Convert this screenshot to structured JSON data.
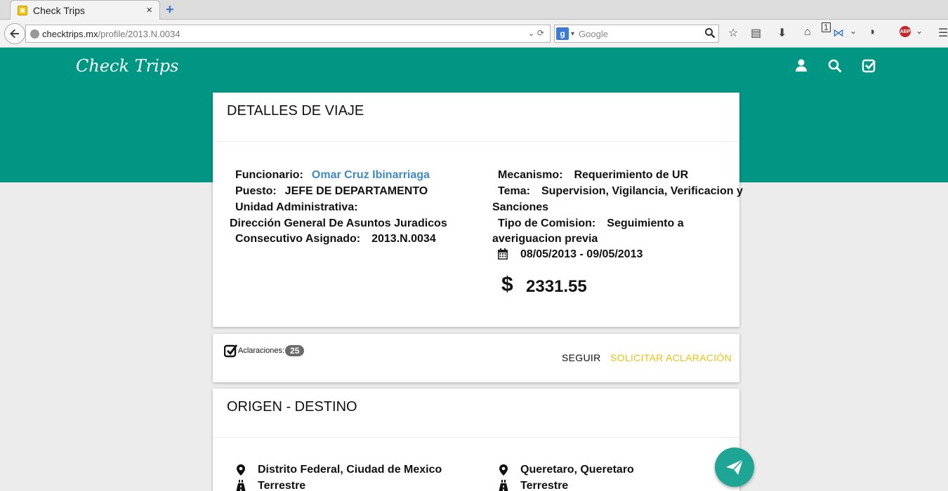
{
  "browser": {
    "tab_title": "Check Trips",
    "tab_close": "×",
    "new_tab": "+",
    "url_host": "checktrips.mx",
    "url_path": "/profile/2013.N.0034",
    "search_placeholder": "Google",
    "toolbar_badge": "1"
  },
  "site": {
    "logo": "Check Trips",
    "header_color": "#009684",
    "icons": [
      "user-icon",
      "search-icon",
      "check-square-icon"
    ]
  },
  "details": {
    "title": "DETALLES DE VIAJE",
    "funcionario_label": "Funcionario:",
    "funcionario_value": "Omar Cruz Ibinarriaga",
    "puesto_label": "Puesto:",
    "puesto_value": "JEFE DE DEPARTAMENTO",
    "unidad_label": "Unidad Administrativa:",
    "unidad_value": "Dirección General De Asuntos Juradicos",
    "consecutivo_label": "Consecutivo Asignado:",
    "consecutivo_value": "2013.N.0034",
    "mecanismo_label": "Mecanismo:",
    "mecanismo_value": "Requerimiento de UR",
    "tema_label": "Tema:",
    "tema_value_1": "Supervision, Vigilancia, Verificacion y",
    "tema_value_2": "Sanciones",
    "tipo_label": "Tipo de Comision:",
    "tipo_value_1": "Seguimiento a",
    "tipo_value_2": "averiguacion previa",
    "fechas": "08/05/2013 - 09/05/2013",
    "currency": "$",
    "monto": "2331.55"
  },
  "actions": {
    "aclaraciones_label": "Aclaraciones:",
    "aclaraciones_count": "25",
    "seguir": "SEGUIR",
    "solicitar": "SOLICITAR ACLARACIÓN"
  },
  "route": {
    "title": "ORIGEN - DESTINO",
    "origen": "Distrito Federal, Ciudad de Mexico",
    "origen_medio": "Terrestre",
    "destino": "Queretaro, Queretaro",
    "destino_medio": "Terrestre"
  }
}
